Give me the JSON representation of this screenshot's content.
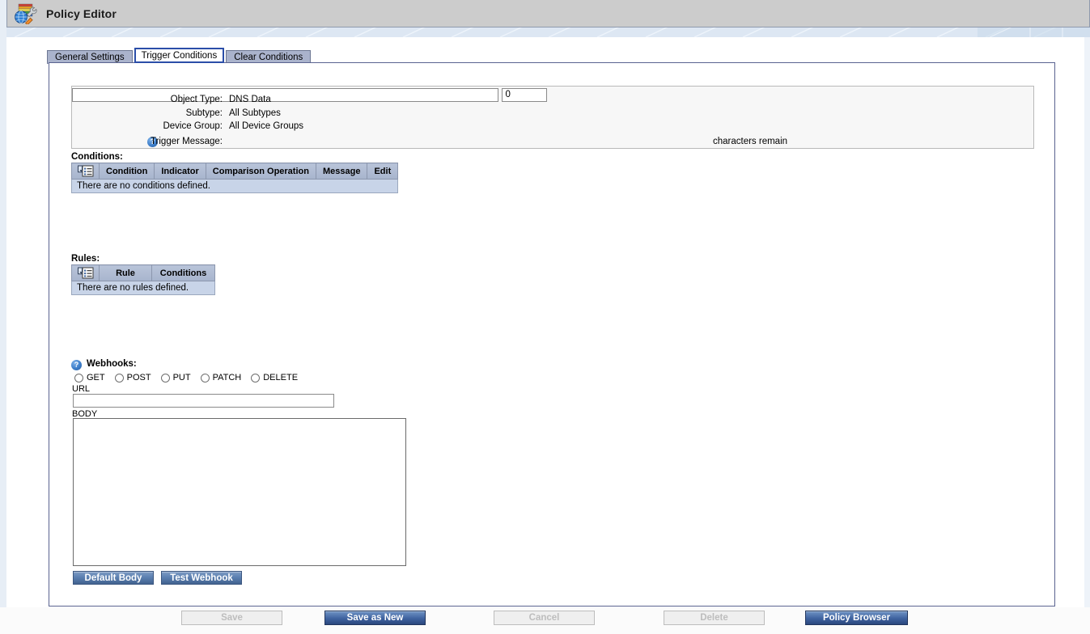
{
  "window": {
    "title": "Policy Editor",
    "icon": "policy-editor-icon"
  },
  "tabs": [
    {
      "label": "General Settings",
      "active": false
    },
    {
      "label": "Trigger Conditions",
      "active": true
    },
    {
      "label": "Clear Conditions",
      "active": false
    }
  ],
  "info": {
    "object_type_label": "Object Type:",
    "object_type_value": "DNS Data",
    "subtype_label": "Subtype:",
    "subtype_value": "All Subtypes",
    "device_group_label": "Device Group:",
    "device_group_value": "All Device Groups",
    "trigger_message_label": "Trigger Message:",
    "trigger_message_value": "",
    "trigger_message_help": "?",
    "characters_count": "0",
    "characters_remain_label": "characters remain"
  },
  "conditions": {
    "section_label": "Conditions:",
    "columns": [
      "",
      "Condition",
      "Indicator",
      "Comparison Operation",
      "Message",
      "Edit"
    ],
    "empty_text": "There are no conditions defined.",
    "rows": []
  },
  "rules": {
    "section_label": "Rules:",
    "columns": [
      "",
      "Rule",
      "Conditions"
    ],
    "empty_text": "There are no rules defined.",
    "rows": []
  },
  "webhooks": {
    "section_label": "Webhooks:",
    "help": "?",
    "methods": [
      {
        "label": "GET",
        "selected": false
      },
      {
        "label": "POST",
        "selected": false
      },
      {
        "label": "PUT",
        "selected": false
      },
      {
        "label": "PATCH",
        "selected": false
      },
      {
        "label": "DELETE",
        "selected": false
      }
    ],
    "url_label": "URL",
    "url_value": "",
    "body_label": "BODY",
    "body_value": "",
    "default_body_button": "Default Body",
    "test_webhook_button": "Test Webhook"
  },
  "footer": {
    "save": "Save",
    "save_as_new": "Save as New",
    "cancel": "Cancel",
    "delete": "Delete",
    "policy_browser": "Policy Browser"
  },
  "colors": {
    "titlebar": "#cccccc",
    "tab_inactive": "#aab3cc",
    "tab_active_border": "#2b4ea8",
    "table_header": "#b0bcd3",
    "table_empty_row": "#c8d4e8",
    "primary_button": "#3f63a0",
    "panel_border": "#5a6390"
  }
}
